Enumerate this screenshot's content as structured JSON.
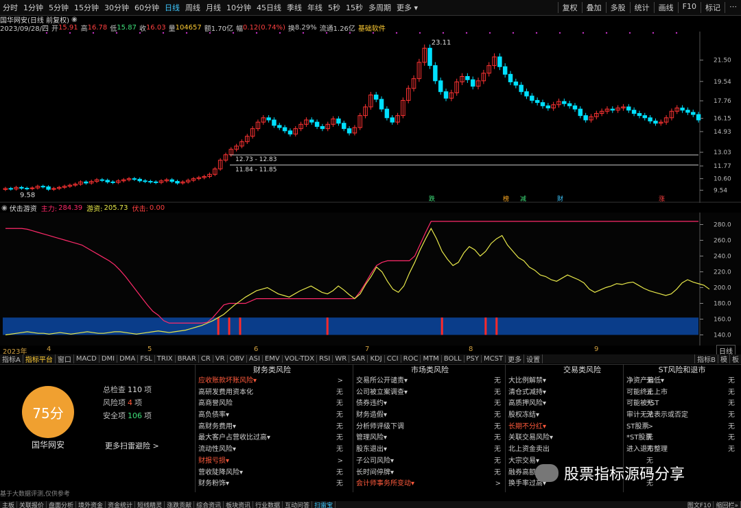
{
  "topbar": {
    "periods": [
      "分时",
      "1分钟",
      "5分钟",
      "15分钟",
      "30分钟",
      "60分钟",
      "日线",
      "周线",
      "月线",
      "10分钟",
      "45日线",
      "季线",
      "年线",
      "5秒",
      "15秒",
      "多周期",
      "更多 ▾"
    ],
    "active": "日线",
    "right": [
      "复权",
      "叠加",
      "多股",
      "统计",
      "画线",
      "F10",
      "标记",
      "⋯"
    ]
  },
  "stock": {
    "name": "国华网安",
    "mode": "(日线 前复权)",
    "date": "2023/09/28/四",
    "open_label": "开",
    "open": "15.91",
    "high_label": "高",
    "high": "16.78",
    "low_label": "低",
    "low": "15.87",
    "close_label": "收",
    "close": "16.03",
    "vol_label": "量",
    "vol": "104657",
    "amt_label": "额",
    "amt": "1.70亿",
    "chg_label": "幅",
    "chg": "0.12(0.74%)",
    "turn_label": "换",
    "turn": "8.29%",
    "float_label": "流通",
    "float": "1.26亿",
    "tag": "基础软件"
  },
  "price_axis": [
    "21.50",
    "19.54",
    "17.76",
    "16.15",
    "14.93",
    "13.03",
    "11.77",
    "10.60",
    "9.54"
  ],
  "annotations": {
    "high": "23.11",
    "low": "9.58",
    "zone_top": "12.73 - 12.83",
    "zone_bottom": "11.84 - 11.85"
  },
  "markers": [
    "跌",
    "榜",
    "减",
    "财",
    "涨"
  ],
  "indicator": {
    "name": "伏击游资",
    "main_label": "主力:",
    "main": "284.39",
    "hot_label": "游资:",
    "hot": "205.73",
    "ambush_label": "伏击:",
    "ambush": "0.00"
  },
  "ind_axis": [
    "280.0",
    "260.0",
    "240.0",
    "220.0",
    "200.0",
    "180.0",
    "160.0",
    "140.0"
  ],
  "dates": [
    "2023年",
    "4",
    "5",
    "6",
    "7",
    "8",
    "9"
  ],
  "period_box": "日线",
  "tabs": [
    "指标A",
    "指标平台",
    "窗口",
    "MACD",
    "DMI",
    "DMA",
    "FSL",
    "TRIX",
    "BRAR",
    "CR",
    "VR",
    "OBV",
    "ASI",
    "EMV",
    "VOL-TDX",
    "RSI",
    "WR",
    "SAR",
    "KDJ",
    "CCI",
    "ROC",
    "MTM",
    "BOLL",
    "PSY",
    "MCST",
    "更多",
    "设置"
  ],
  "tabs_active": "指标平台",
  "tabs_right": [
    "指标B",
    "模",
    "板"
  ],
  "panel": {
    "score": "75分",
    "total_label": "总检查",
    "total": "110",
    "unit": "项",
    "risk_label": "风险项",
    "risk": "4",
    "safe_label": "安全项",
    "safe": "106",
    "stock": "国华网安",
    "more": "更多扫雷避险 >",
    "source": "基于大数据评测,仅供参考"
  },
  "columns": [
    {
      "title": "财务类风险",
      "items": [
        {
          "t": "应收账款坏账风险▾",
          "v": ">",
          "red": true
        },
        {
          "t": "高研发费用资本化",
          "v": "无"
        },
        {
          "t": "高商誉风险",
          "v": "无"
        },
        {
          "t": "高负债率▾",
          "v": "无"
        },
        {
          "t": "高财务费用▾",
          "v": "无"
        },
        {
          "t": "最大客户占营收比过高▾",
          "v": "无"
        },
        {
          "t": "流动性风险▾",
          "v": "无"
        },
        {
          "t": "财报亏损▾",
          "v": ">",
          "red": true
        },
        {
          "t": "营收陡降风险▾",
          "v": "无"
        },
        {
          "t": "财务粉饰▾",
          "v": "无"
        }
      ]
    },
    {
      "title": "市场类风险",
      "items": [
        {
          "t": "交易所公开谴责▾",
          "v": "无"
        },
        {
          "t": "公司被立案调查▾",
          "v": "无"
        },
        {
          "t": "债券违约▾",
          "v": "无"
        },
        {
          "t": "财务造假▾",
          "v": "无"
        },
        {
          "t": "分析师评级下调",
          "v": "无"
        },
        {
          "t": "管理风险▾",
          "v": "无"
        },
        {
          "t": "股东退出▾",
          "v": "无"
        },
        {
          "t": "子公司风险▾",
          "v": "无"
        },
        {
          "t": "长时间停牌▾",
          "v": "无"
        },
        {
          "t": "会计师事务所变动▾",
          "v": ">",
          "red": true
        }
      ]
    },
    {
      "title": "交易类风险",
      "items": [
        {
          "t": "大比例解禁▾",
          "v": "无"
        },
        {
          "t": "清仓式减持▾",
          "v": "无"
        },
        {
          "t": "高质押风险▾",
          "v": "无"
        },
        {
          "t": "股权冻结▾",
          "v": "无"
        },
        {
          "t": "长期不分红▾",
          "v": ">",
          "red": true
        },
        {
          "t": "关联交易风险▾",
          "v": "无"
        },
        {
          "t": "北上资金卖出",
          "v": "无"
        },
        {
          "t": "大宗交易▾",
          "v": "无"
        },
        {
          "t": "融券高额▾",
          "v": "无"
        },
        {
          "t": "换手率过高▾",
          "v": "无"
        }
      ]
    },
    {
      "title": "ST风险和退市",
      "items": [
        {
          "t": "净资产偏低▾",
          "v": "无"
        },
        {
          "t": "可能终止上市",
          "v": "无"
        },
        {
          "t": "可能被*ST",
          "v": "无"
        },
        {
          "t": "审计无法表示或否定",
          "v": "无"
        },
        {
          "t": "ST股票",
          "v": "无"
        },
        {
          "t": "*ST股票",
          "v": "无"
        },
        {
          "t": "进入退市整理",
          "v": "无"
        }
      ]
    }
  ],
  "watermark": "股票指标源码分享",
  "bottom": [
    "主板",
    "关联报价",
    "盘面分析",
    "境外资金",
    "资金统计",
    "短线精灵",
    "涨跌贡献",
    "综合资讯",
    "板块资讯",
    "行业数据",
    "互动问答",
    "扫雷宝"
  ],
  "bottom_active": "扫雷宝",
  "bottom_right": [
    "图文F10",
    "缩回栏»"
  ],
  "colors": {
    "up": "#ff3333",
    "down": "#00e0ff",
    "main_line": "#ff2a6a",
    "hot_line": "#e8e84a",
    "band": "#0a3d8a",
    "accent": "#3ec8ff"
  },
  "chart_data": [
    {
      "type": "candlestick",
      "title": "国华网安 日线 前复权",
      "ylim": [
        9.0,
        23.5
      ],
      "x_ticks": [
        "2023年",
        "4",
        "5",
        "6",
        "7",
        "8",
        "9"
      ],
      "closes": [
        9.7,
        9.65,
        9.8,
        9.72,
        9.68,
        9.75,
        9.9,
        9.85,
        9.62,
        9.7,
        9.8,
        9.9,
        10.0,
        10.1,
        10.3,
        10.2,
        10.35,
        10.5,
        10.45,
        10.3,
        10.25,
        10.4,
        10.5,
        10.6,
        10.55,
        10.4,
        10.35,
        10.3,
        10.25,
        10.4,
        10.5,
        10.35,
        10.2,
        10.3,
        10.45,
        10.6,
        10.7,
        10.8,
        11.0,
        11.5,
        12.3,
        12.8,
        13.3,
        13.6,
        14.0,
        14.5,
        15.2,
        15.8,
        16.2,
        16.0,
        15.5,
        15.3,
        15.0,
        14.7,
        15.2,
        15.6,
        16.0,
        15.8,
        15.4,
        15.2,
        15.6,
        16.1,
        15.7,
        15.2,
        14.8,
        15.3,
        16.4,
        17.2,
        18.3,
        17.9,
        17.0,
        16.2,
        15.8,
        16.4,
        17.8,
        18.9,
        19.8,
        21.3,
        22.6,
        21.0,
        19.6,
        18.6,
        18.0,
        18.5,
        19.5,
        20.0,
        19.7,
        19.1,
        19.6,
        20.3,
        21.0,
        21.8,
        20.9,
        20.2,
        19.5,
        19.2,
        18.6,
        18.2,
        17.8,
        17.6,
        17.3,
        17.1,
        17.4,
        17.7,
        17.5,
        17.3,
        17.0,
        16.4,
        16.0,
        16.3,
        16.6,
        16.8,
        17.0,
        16.9,
        17.1,
        17.2,
        16.9,
        16.6,
        16.4,
        16.2,
        15.9,
        15.7,
        15.8,
        16.2,
        16.8,
        17.1,
        16.9,
        16.7,
        16.5,
        16.0
      ]
    },
    {
      "type": "line",
      "title": "伏击游资",
      "series": [
        {
          "name": "主力",
          "values": [
            275,
            275,
            275,
            275,
            274,
            272,
            270,
            268,
            266,
            264,
            262,
            260,
            258,
            256,
            254,
            250,
            246,
            242,
            238,
            234,
            229,
            222,
            214,
            205,
            196,
            187,
            178,
            170,
            165,
            158,
            155,
            155,
            155,
            155,
            155,
            155,
            155,
            156,
            162,
            170,
            178,
            180,
            180,
            180,
            180,
            183,
            186,
            186,
            186,
            186,
            186,
            186,
            186,
            186,
            186,
            186,
            186,
            186,
            186,
            186,
            186,
            186,
            186,
            186,
            186,
            195,
            206,
            218,
            228,
            232,
            234,
            234,
            234,
            234,
            234,
            240,
            255,
            270,
            284,
            284,
            284,
            284,
            284,
            284,
            284,
            284,
            284,
            284,
            284,
            284,
            284,
            284,
            284,
            284,
            284,
            284,
            284,
            284,
            284,
            284,
            284,
            284,
            284,
            284,
            284,
            284,
            284,
            284,
            284,
            284,
            284,
            284,
            284,
            284,
            284,
            284,
            284,
            284,
            284,
            284,
            284,
            284,
            284,
            284,
            284,
            284,
            284,
            284
          ]
        },
        {
          "name": "游资",
          "values": [
            140,
            141,
            142,
            143,
            144,
            143,
            142,
            142,
            141,
            142,
            143,
            142,
            141,
            142,
            143,
            144,
            143,
            142,
            142,
            143,
            144,
            144,
            143,
            142,
            141,
            142,
            143,
            144,
            145,
            144,
            143,
            144,
            145,
            146,
            148,
            150,
            152,
            155,
            158,
            162,
            166,
            172,
            178,
            183,
            188,
            192,
            196,
            198,
            200,
            196,
            192,
            190,
            188,
            192,
            196,
            199,
            202,
            198,
            194,
            192,
            196,
            202,
            197,
            191,
            186,
            192,
            204,
            214,
            226,
            220,
            208,
            198,
            194,
            202,
            218,
            232,
            248,
            262,
            275,
            262,
            246,
            236,
            228,
            232,
            244,
            252,
            248,
            240,
            246,
            256,
            262,
            266,
            254,
            246,
            238,
            234,
            226,
            222,
            216,
            214,
            210,
            208,
            212,
            216,
            213,
            210,
            206,
            198,
            194,
            197,
            200,
            202,
            205,
            204,
            206,
            207,
            203,
            199,
            196,
            194,
            192,
            190,
            192,
            198,
            206,
            210,
            207,
            205,
            203,
            198
          ]
        },
        {
          "name": "伏击",
          "values": [
            0
          ]
        }
      ],
      "ylim": [
        130,
        290
      ]
    }
  ]
}
